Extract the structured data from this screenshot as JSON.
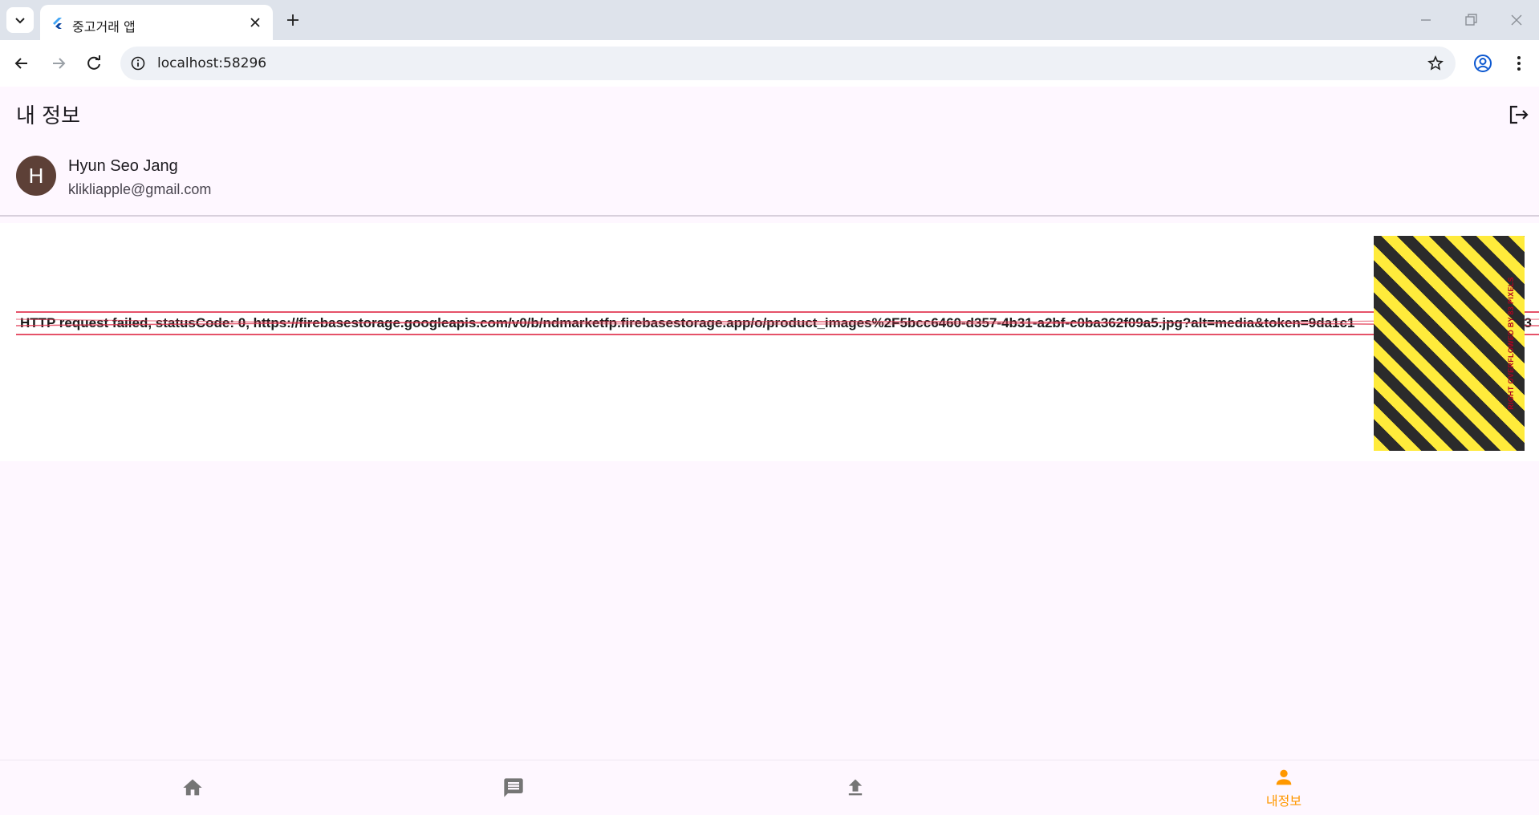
{
  "browser": {
    "tab_title": "중고거래 앱",
    "url": "localhost:58296"
  },
  "app": {
    "title": "내 정보",
    "user": {
      "avatar_initial": "H",
      "name": "Hyun Seo Jang",
      "email": "klikliapple@gmail.com"
    },
    "error": {
      "message": "HTTP request failed, statusCode: 0, https://firebasestorage.googleapis.com/v0/b/ndmarketfp.firebasestorage.app/o/product_images%2F5bcc6460-d357-4b31-a2bf-c0ba362f09a5.jpg?alt=media&token=9da1c1",
      "message_tail": "83",
      "overflow_label": "RIGHT OVERFLOWED BY 83 PIXELS"
    },
    "bottom_nav": {
      "items": [
        {
          "icon": "home-icon",
          "label": "",
          "selected": false
        },
        {
          "icon": "chat-icon",
          "label": "",
          "selected": false
        },
        {
          "icon": "upload-icon",
          "label": "",
          "selected": false
        },
        {
          "icon": "person-icon",
          "label": "내정보",
          "selected": true
        }
      ],
      "selected_color": "#ff9800",
      "unselected_color": "#757575"
    }
  },
  "colors": {
    "avatar_bg": "#5d4037",
    "app_bg": "#fef7ff",
    "error_line": "#e0344f"
  }
}
